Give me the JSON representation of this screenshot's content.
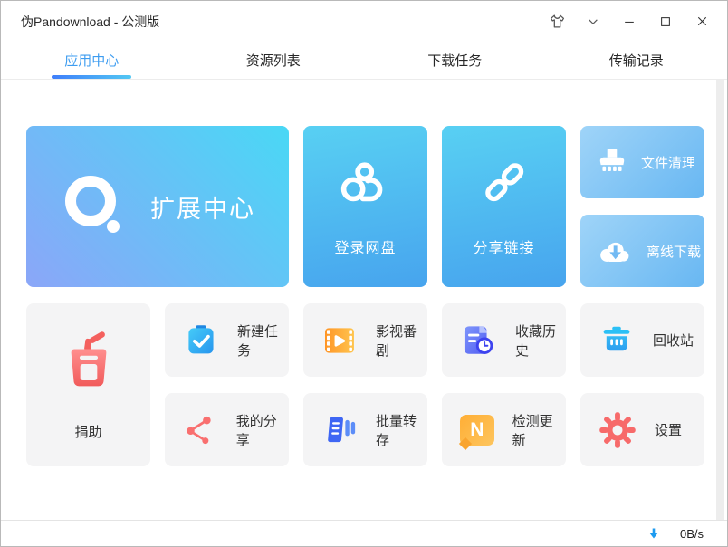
{
  "window": {
    "title": "伪Pandownload - 公测版"
  },
  "tabs": {
    "items": [
      {
        "label": "应用中心"
      },
      {
        "label": "资源列表"
      },
      {
        "label": "下载任务"
      },
      {
        "label": "传输记录"
      }
    ],
    "active_index": 0
  },
  "tiles": {
    "extension_center": {
      "label": "扩展中心"
    },
    "login_netdisk": {
      "label": "登录网盘"
    },
    "share_link": {
      "label": "分享链接"
    },
    "file_clean": {
      "label": "文件清理"
    },
    "offline_download": {
      "label": "离线下载"
    },
    "new_task": {
      "label": "新建任务"
    },
    "movies_anime": {
      "label": "影视番剧"
    },
    "donate": {
      "label": "捐助"
    },
    "favorites_history": {
      "label": "收藏历史"
    },
    "recycle_bin": {
      "label": "回收站"
    },
    "my_shares": {
      "label": "我的分享"
    },
    "batch_transfer": {
      "label": "批量转存"
    },
    "check_update": {
      "label": "检测更新",
      "icon_letter": "N"
    },
    "settings": {
      "label": "设置"
    }
  },
  "statusbar": {
    "download_speed": "0B/s"
  },
  "colors": {
    "active_tab": "#3d9cf0",
    "tab_underline_start": "#3f7efb",
    "tab_underline_end": "#53c8f3",
    "big_tile_gradient": [
      "#8ba6f8",
      "#49d8f5"
    ],
    "blue_tile_gradient": [
      "#58d0f3",
      "#47a4ee"
    ],
    "light_blue_tile_gradient": [
      "#9fd4f8",
      "#68b7f2"
    ],
    "gray_tile": "#f4f4f5",
    "download_arrow": "#1d9bf0"
  }
}
